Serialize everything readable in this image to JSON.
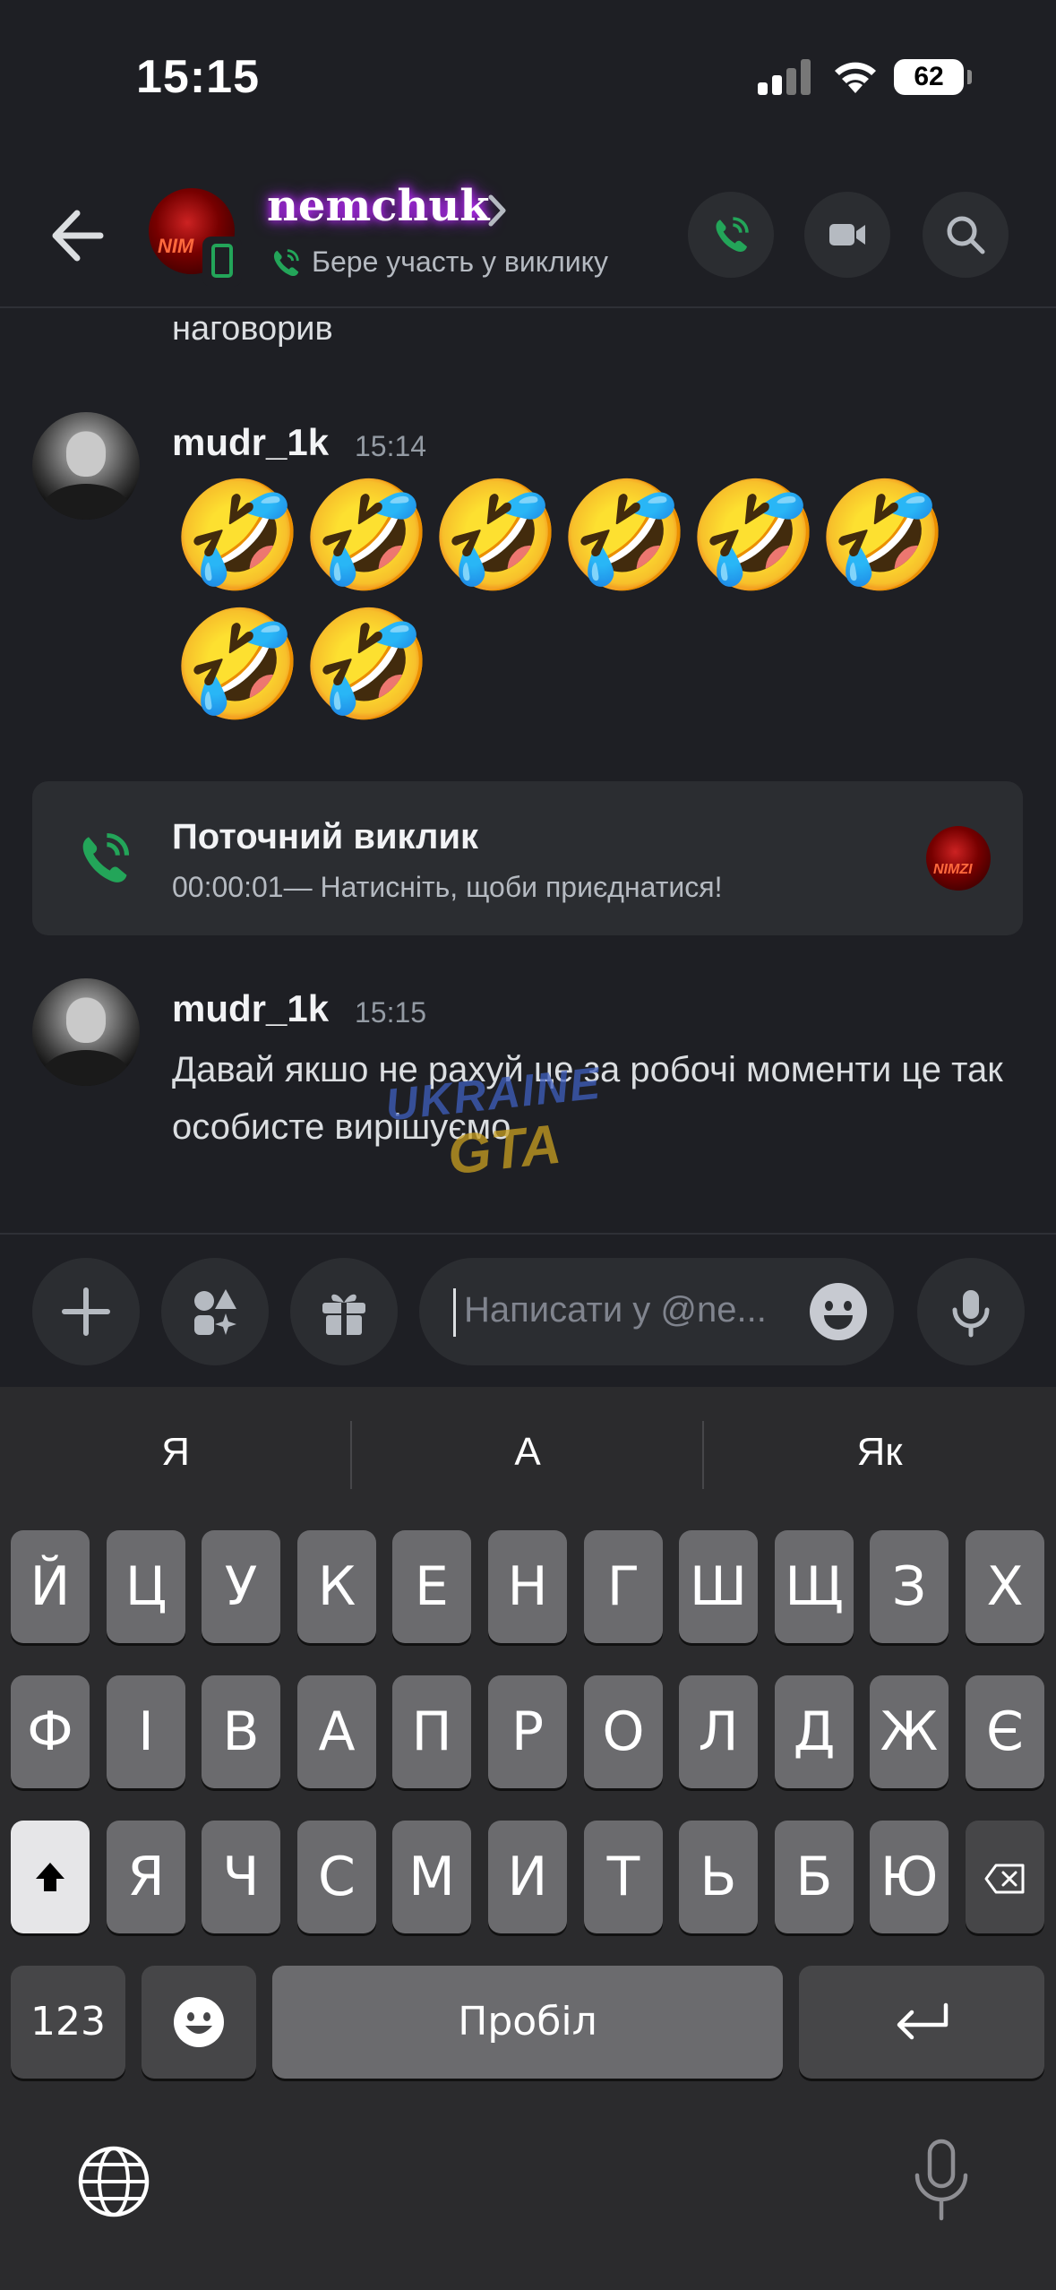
{
  "status_bar": {
    "time": "15:15",
    "battery": "62"
  },
  "header": {
    "name": "nemchuk",
    "status": "Бере участь у виклику",
    "avatar_text": "NIM"
  },
  "messages": {
    "continued_text": "наговорив",
    "first": {
      "author": "mudr_1k",
      "time": "15:14",
      "emojis": [
        "🤣",
        "🤣",
        "🤣",
        "🤣",
        "🤣",
        "🤣",
        "🤣",
        "🤣"
      ]
    },
    "call": {
      "title": "Поточний виклик",
      "subtitle": "00:00:01— Натисніть, щоби приєднатися!",
      "avatar_text": "NIMZI"
    },
    "second": {
      "author": "mudr_1k",
      "time": "15:15",
      "text": "Давай якшо не рахуй це за робочі моменти це так особисте вирішуємо"
    },
    "watermark": {
      "line1": "UKRAINE",
      "line2": "GTA"
    }
  },
  "composer": {
    "placeholder": "Написати у @ne..."
  },
  "keyboard": {
    "suggestions": [
      "Я",
      "А",
      "Як"
    ],
    "row1": [
      "Й",
      "Ц",
      "У",
      "К",
      "Е",
      "Н",
      "Г",
      "Ш",
      "Щ",
      "З",
      "Х"
    ],
    "row2": [
      "Ф",
      "І",
      "В",
      "А",
      "П",
      "Р",
      "О",
      "Л",
      "Д",
      "Ж",
      "Є"
    ],
    "row3": [
      "Я",
      "Ч",
      "С",
      "М",
      "И",
      "Т",
      "Ь",
      "Б",
      "Ю"
    ],
    "numbers_label": "123",
    "space_label": "Пробіл"
  },
  "colors": {
    "background": "#1e1f24",
    "surface": "#2b2d31",
    "green": "#23a559",
    "name_glow": "#c02cff"
  }
}
